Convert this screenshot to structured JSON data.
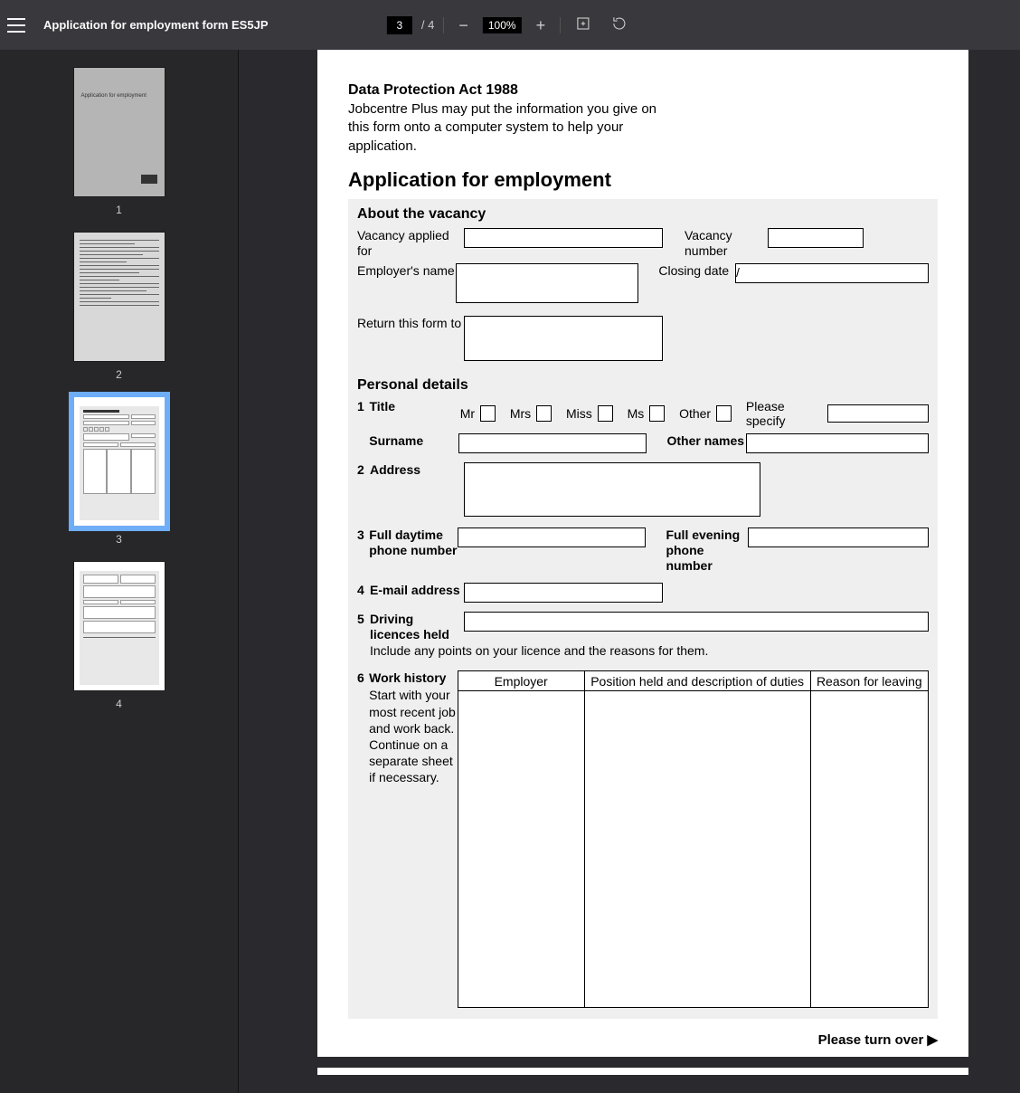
{
  "toolbar": {
    "doc_title": "Application for employment form ES5JP",
    "current_page": "3",
    "total_pages": "/ 4",
    "zoom": "100%"
  },
  "thumbs": {
    "p1_text": "Application for employment",
    "n1": "1",
    "n2": "2",
    "n3": "3",
    "n4": "4"
  },
  "doc": {
    "dp_head": "Data Protection Act 1988",
    "dp_text": "Jobcentre Plus may put the information you give on this form onto a computer system to help your application.",
    "title": "Application for employment",
    "about_head": "About the vacancy",
    "vacancy_applied": "Vacancy applied for",
    "vacancy_number": "Vacancy number",
    "employer_name": "Employer's name",
    "closing_date": "Closing date",
    "closing_date_value": "/                  /",
    "return_to": "Return this form to",
    "personal_head": "Personal details",
    "q1_num": "1",
    "q1_label": "Title",
    "title_mr": "Mr",
    "title_mrs": "Mrs",
    "title_miss": "Miss",
    "title_ms": "Ms",
    "title_other": "Other",
    "please_specify": "Please specify",
    "surname": "Surname",
    "other_names": "Other names",
    "q2_num": "2",
    "q2_label": "Address",
    "q3_num": "3",
    "q3_day": "Full daytime phone number",
    "q3_eve": "Full evening phone number",
    "q4_num": "4",
    "q4_label": "E-mail address",
    "q5_num": "5",
    "q5_label": "Driving licences held",
    "q5_help": "Include any points on your licence and the reasons for them.",
    "q6_num": "6",
    "q6_label": "Work history",
    "q6_help": "Start with your most recent job and work back. Continue on a separate sheet if necessary.",
    "wh_employer": "Employer",
    "wh_position": "Position held and description of duties",
    "wh_reason": "Reason for leaving",
    "turnover": "Please turn over   ▶"
  }
}
